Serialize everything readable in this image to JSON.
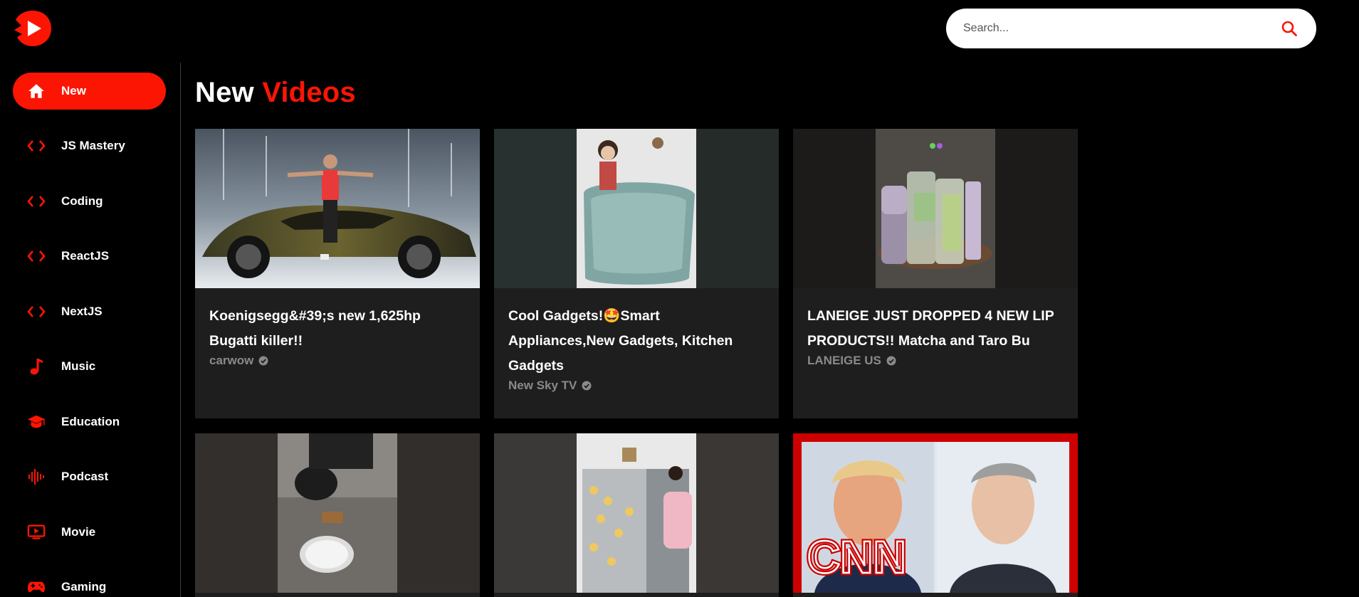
{
  "header": {
    "logo_icon": "youtube-play-logo",
    "search": {
      "placeholder": "Search...",
      "value": ""
    },
    "search_icon": "search-icon",
    "accent_color": "#fc1503"
  },
  "sidebar": {
    "items": [
      {
        "label": "New",
        "icon": "home-icon",
        "active": true
      },
      {
        "label": "JS Mastery",
        "icon": "code-icon",
        "active": false
      },
      {
        "label": "Coding",
        "icon": "code-icon",
        "active": false
      },
      {
        "label": "ReactJS",
        "icon": "code-icon",
        "active": false
      },
      {
        "label": "NextJS",
        "icon": "code-icon",
        "active": false
      },
      {
        "label": "Music",
        "icon": "music-note-icon",
        "active": false
      },
      {
        "label": "Education",
        "icon": "graduation-cap-icon",
        "active": false
      },
      {
        "label": "Podcast",
        "icon": "audio-wave-icon",
        "active": false
      },
      {
        "label": "Movie",
        "icon": "tv-play-icon",
        "active": false
      },
      {
        "label": "Gaming",
        "icon": "gamepad-icon",
        "active": false
      }
    ]
  },
  "main": {
    "heading_white": "New",
    "heading_red": "Videos",
    "videos": [
      {
        "title": "Koenigsegg&#39;s new 1,625hp Bugatti killer!!",
        "channel": "carwow",
        "verified": true
      },
      {
        "title": "Cool Gadgets!🤩Smart Appliances,New Gadgets, Kitchen Gadgets",
        "channel": "New Sky TV",
        "verified": true
      },
      {
        "title": "LANEIGE JUST DROPPED 4 NEW LIP PRODUCTS!! Matcha and Taro Bu",
        "channel": "LANEIGE US",
        "verified": true
      },
      {
        "title": "",
        "channel": ""
      },
      {
        "title": "",
        "channel": ""
      },
      {
        "title": "",
        "channel": "",
        "thumb_text": "CNN"
      }
    ]
  }
}
